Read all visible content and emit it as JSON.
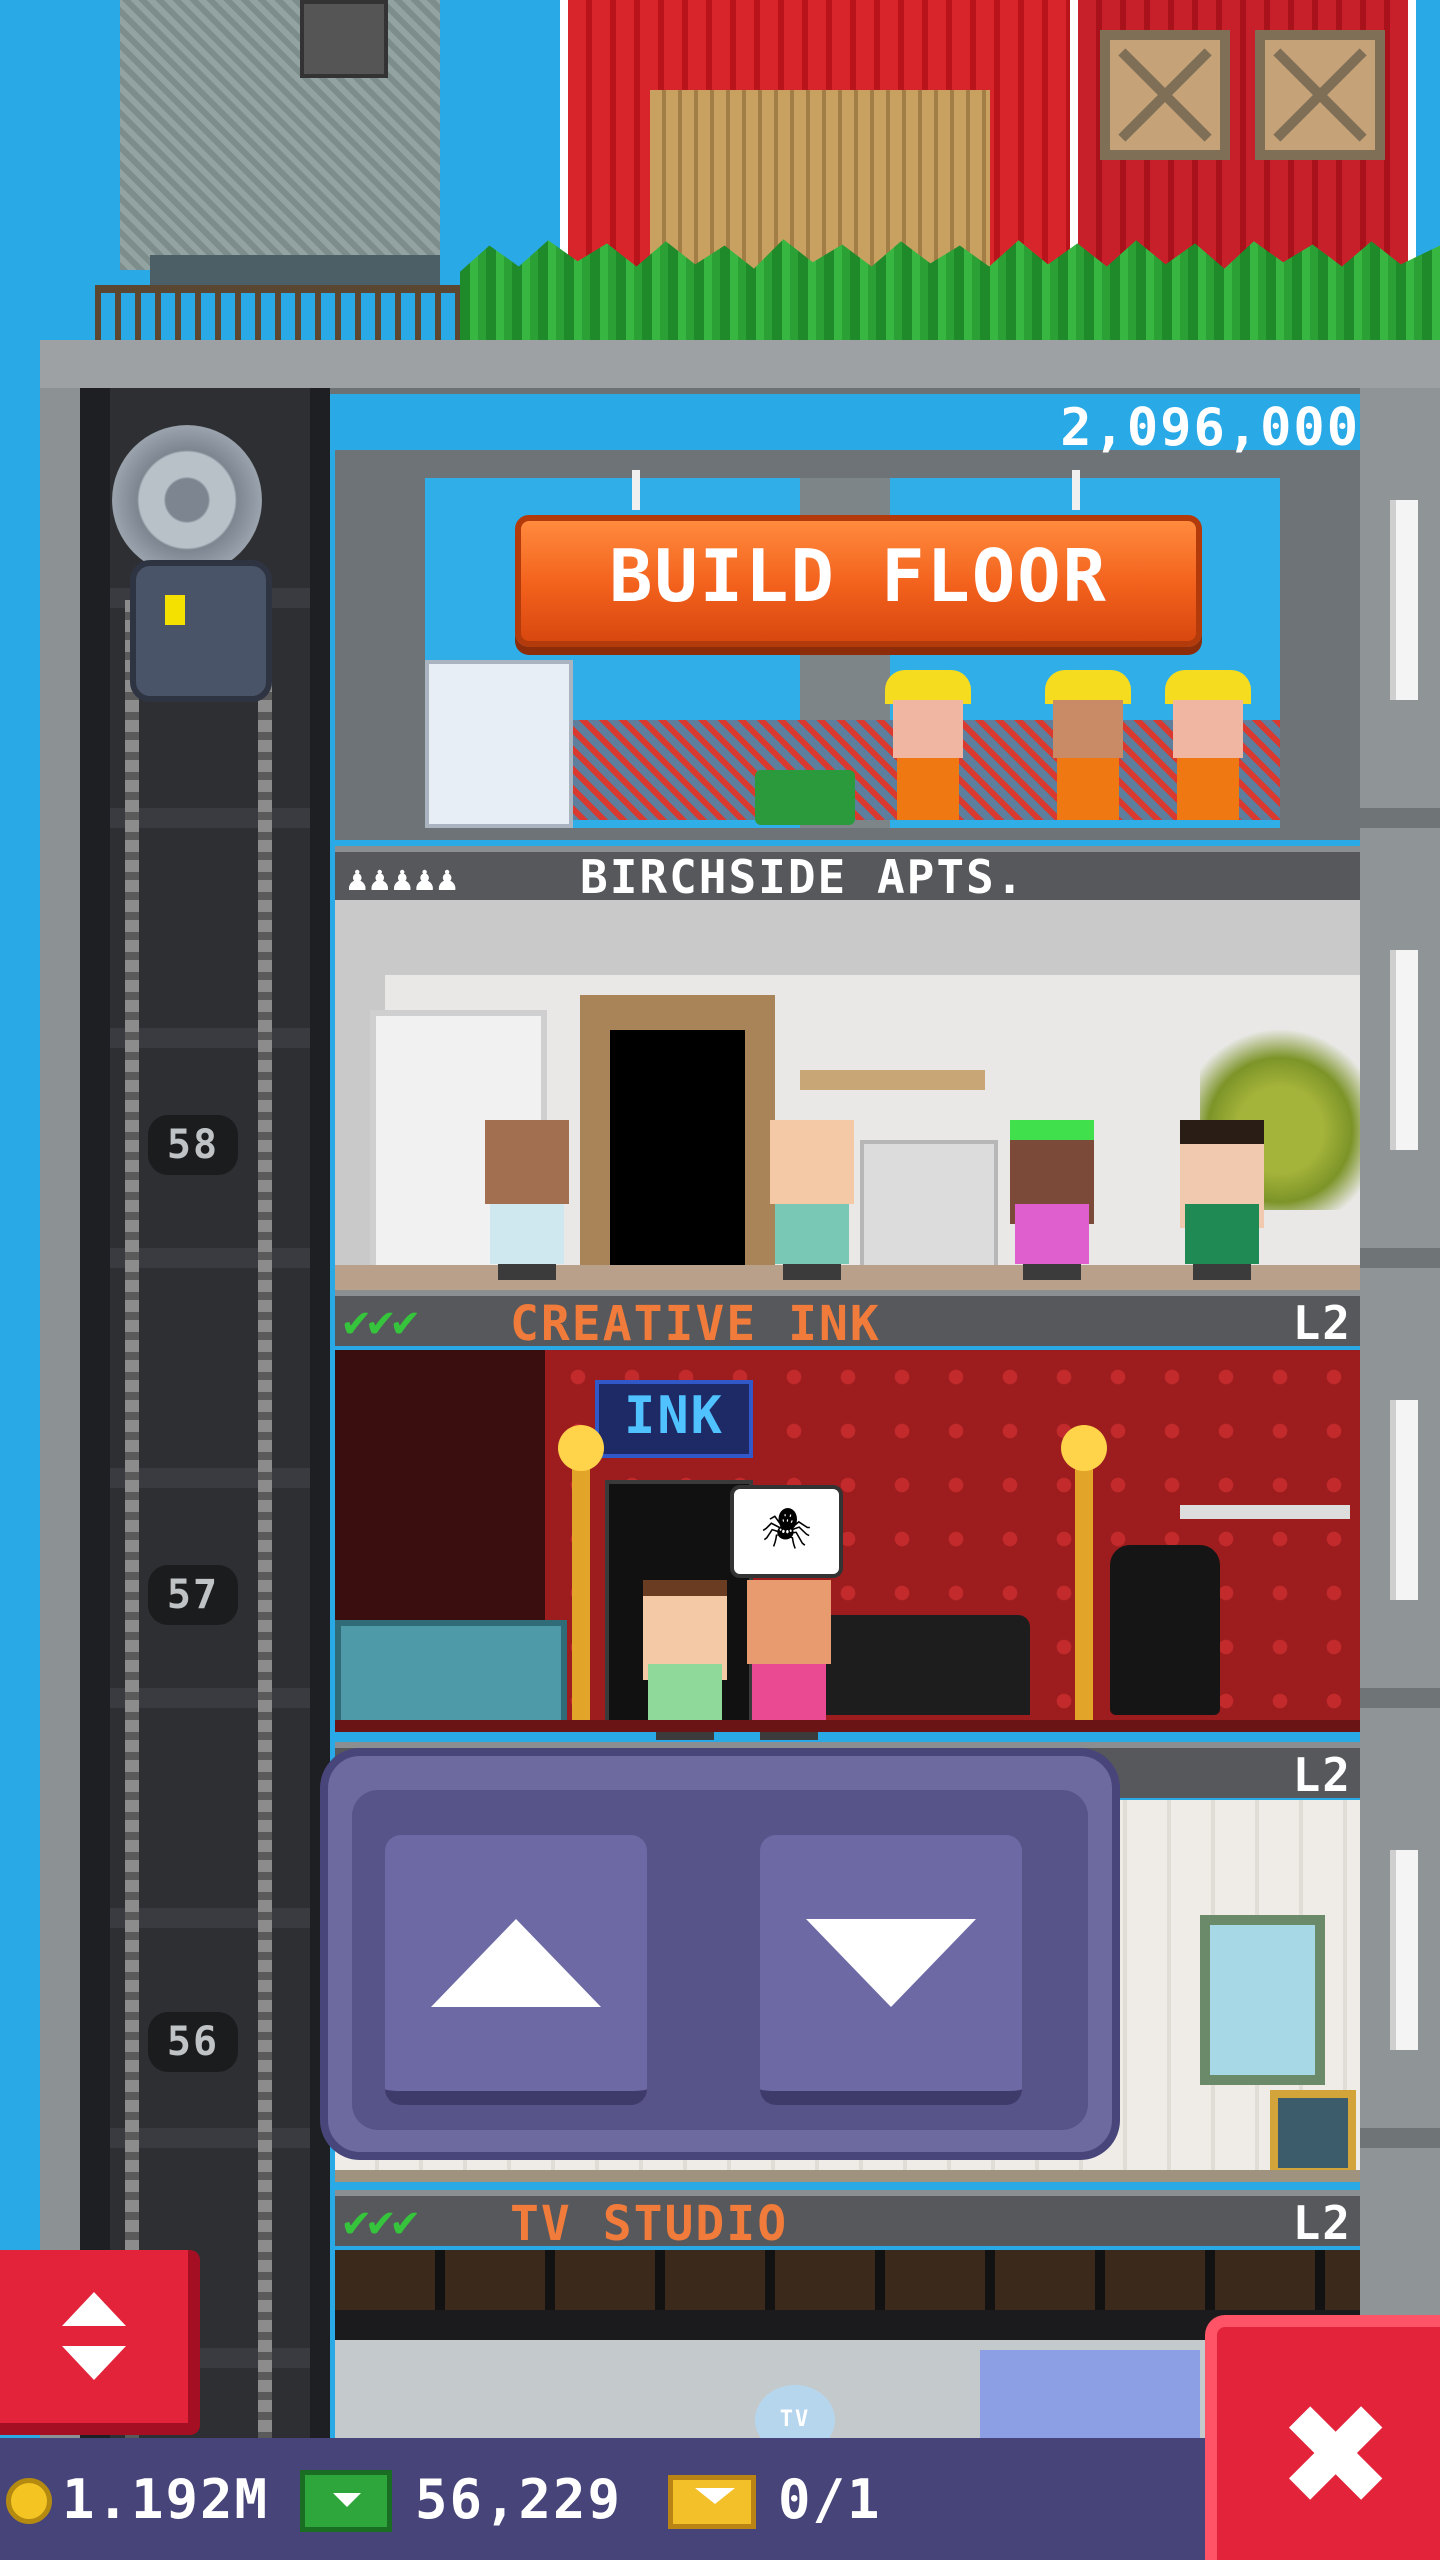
{
  "build": {
    "cost": "2,096,000",
    "button_label": "BUILD FLOOR"
  },
  "floors": [
    {
      "name": "BIRCHSIDE APTS.",
      "occupancy_icons": "♟♟♟♟♟",
      "type": "residential"
    },
    {
      "name": "CREATIVE INK",
      "stock_checks": "✔✔✔",
      "level": "L2"
    },
    {
      "name": "",
      "level": "L2"
    },
    {
      "name": "TV STUDIO",
      "stock_checks": "✔✔✔",
      "level": "L2"
    }
  ],
  "elevator": {
    "floor_numbers": [
      "58",
      "57",
      "56"
    ]
  },
  "controls": {
    "up_icon": "arrow-up-icon",
    "down_icon": "arrow-down-icon",
    "elevator_toggle_icon": "up-down-arrows-icon",
    "close_icon": "close-icon",
    "close_glyph": "✖"
  },
  "ink_speech_glyph": "🕷",
  "ink_sign_text": "INK",
  "tv_logo_text": "TV",
  "status": {
    "coins": "1.192M",
    "bux": "56,229",
    "tickets": "0/1"
  },
  "colors": {
    "sky": "#29a9e6",
    "build_button": "#f2601c",
    "floor_name": "#f07b3a",
    "check": "#35c43c",
    "pad": "#6d6a9f",
    "corner_button": "#e2233a",
    "status_bar": "#47447a"
  }
}
